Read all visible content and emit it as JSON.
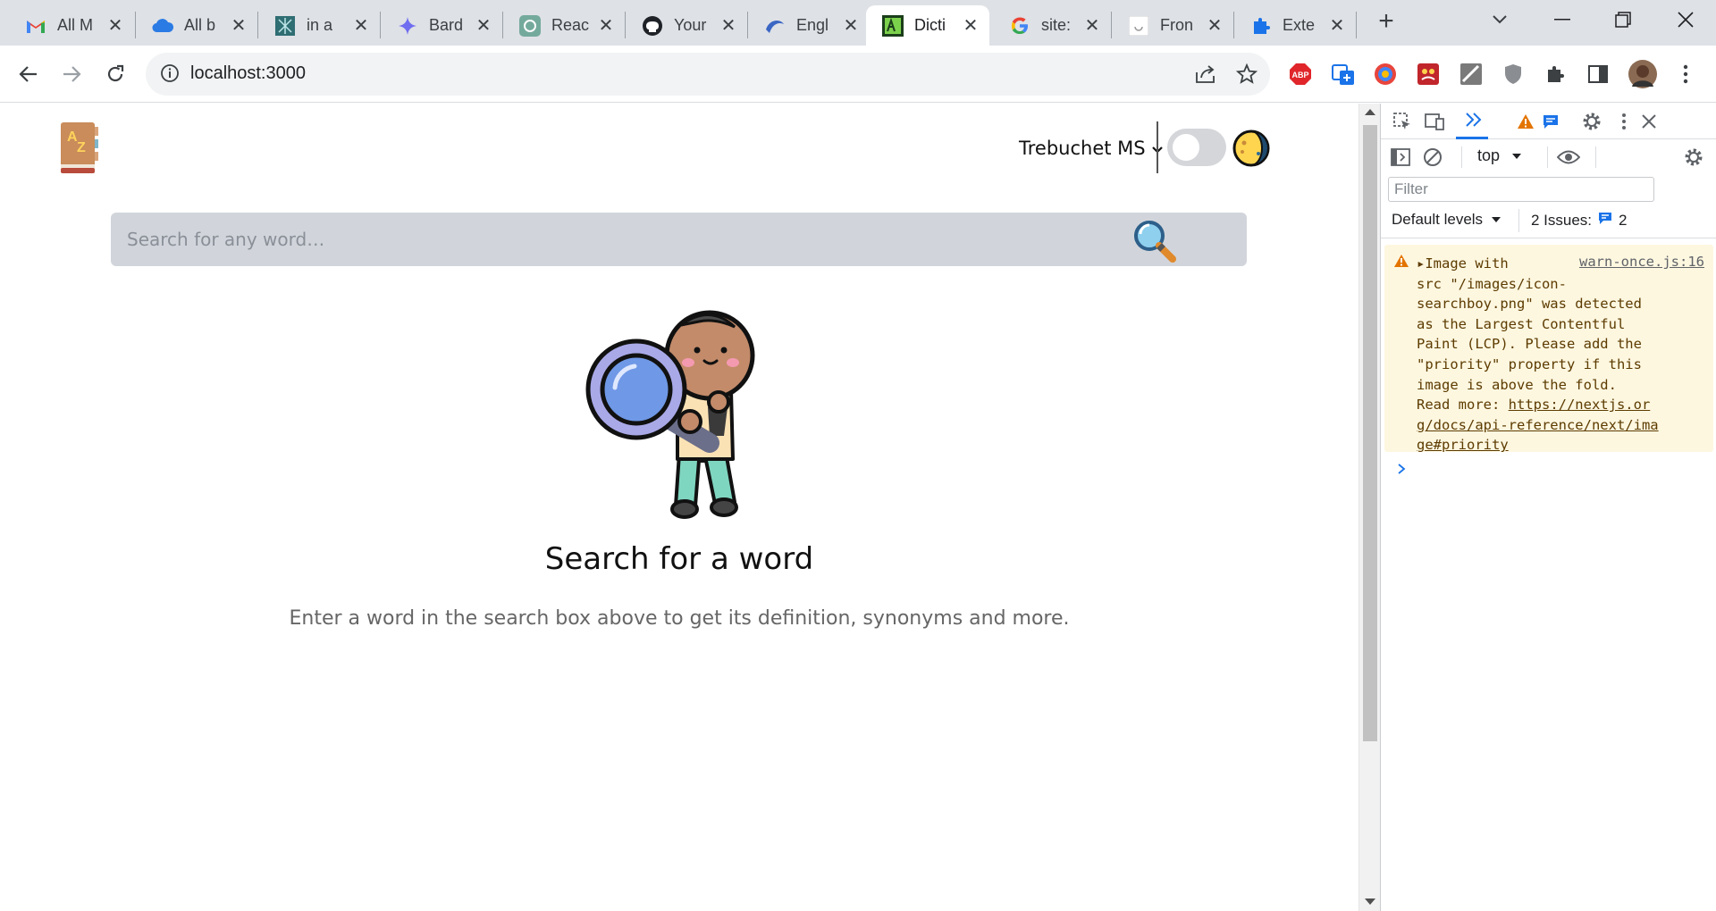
{
  "tabs": [
    {
      "title": "All M",
      "icon": "gmail-icon"
    },
    {
      "title": "All b",
      "icon": "cloud-icon"
    },
    {
      "title": "in a",
      "icon": "generic-site-icon"
    },
    {
      "title": "Bard",
      "icon": "bard-icon"
    },
    {
      "title": "Reac",
      "icon": "openai-icon"
    },
    {
      "title": "Your",
      "icon": "github-icon"
    },
    {
      "title": "Engl",
      "icon": "blue-swirl-icon"
    },
    {
      "title": "Dicti",
      "icon": "dictionary-favicon"
    },
    {
      "title": "site:",
      "icon": "google-icon"
    },
    {
      "title": "Fron",
      "icon": "white-page-icon"
    },
    {
      "title": "Exte",
      "icon": "puzzle-icon"
    }
  ],
  "active_tab_index": 7,
  "address_bar": {
    "url": "localhost:3000"
  },
  "page": {
    "font_select": "Trebuchet MS",
    "search_placeholder": "Search for any word…",
    "empty_title": "Search for a word",
    "empty_description": "Enter a word in the search box above to get its definition, synonyms and more."
  },
  "devtools": {
    "context": "top",
    "filter_placeholder": "Filter",
    "levels_label": "Default levels",
    "issues_label": "2 Issues:",
    "issues_count": "2",
    "warning": {
      "source": "warn-once.js:16",
      "line1": "Image with",
      "body": "src \"/images/icon-\nsearchboy.png\" was detected\nas the Largest Contentful\nPaint (LCP). Please add the\n\"priority\" property if this\nimage is above the fold.\nRead more: ",
      "link": "https://nextjs.or\ng/docs/api-reference/next/ima\nge#priority"
    },
    "prompt": ">"
  },
  "colors": {
    "tabstrip": "#dee1e6",
    "search_bg": "#d1d5db",
    "warning_bg": "#fef7e0",
    "devtools_accent": "#1a73e8"
  }
}
